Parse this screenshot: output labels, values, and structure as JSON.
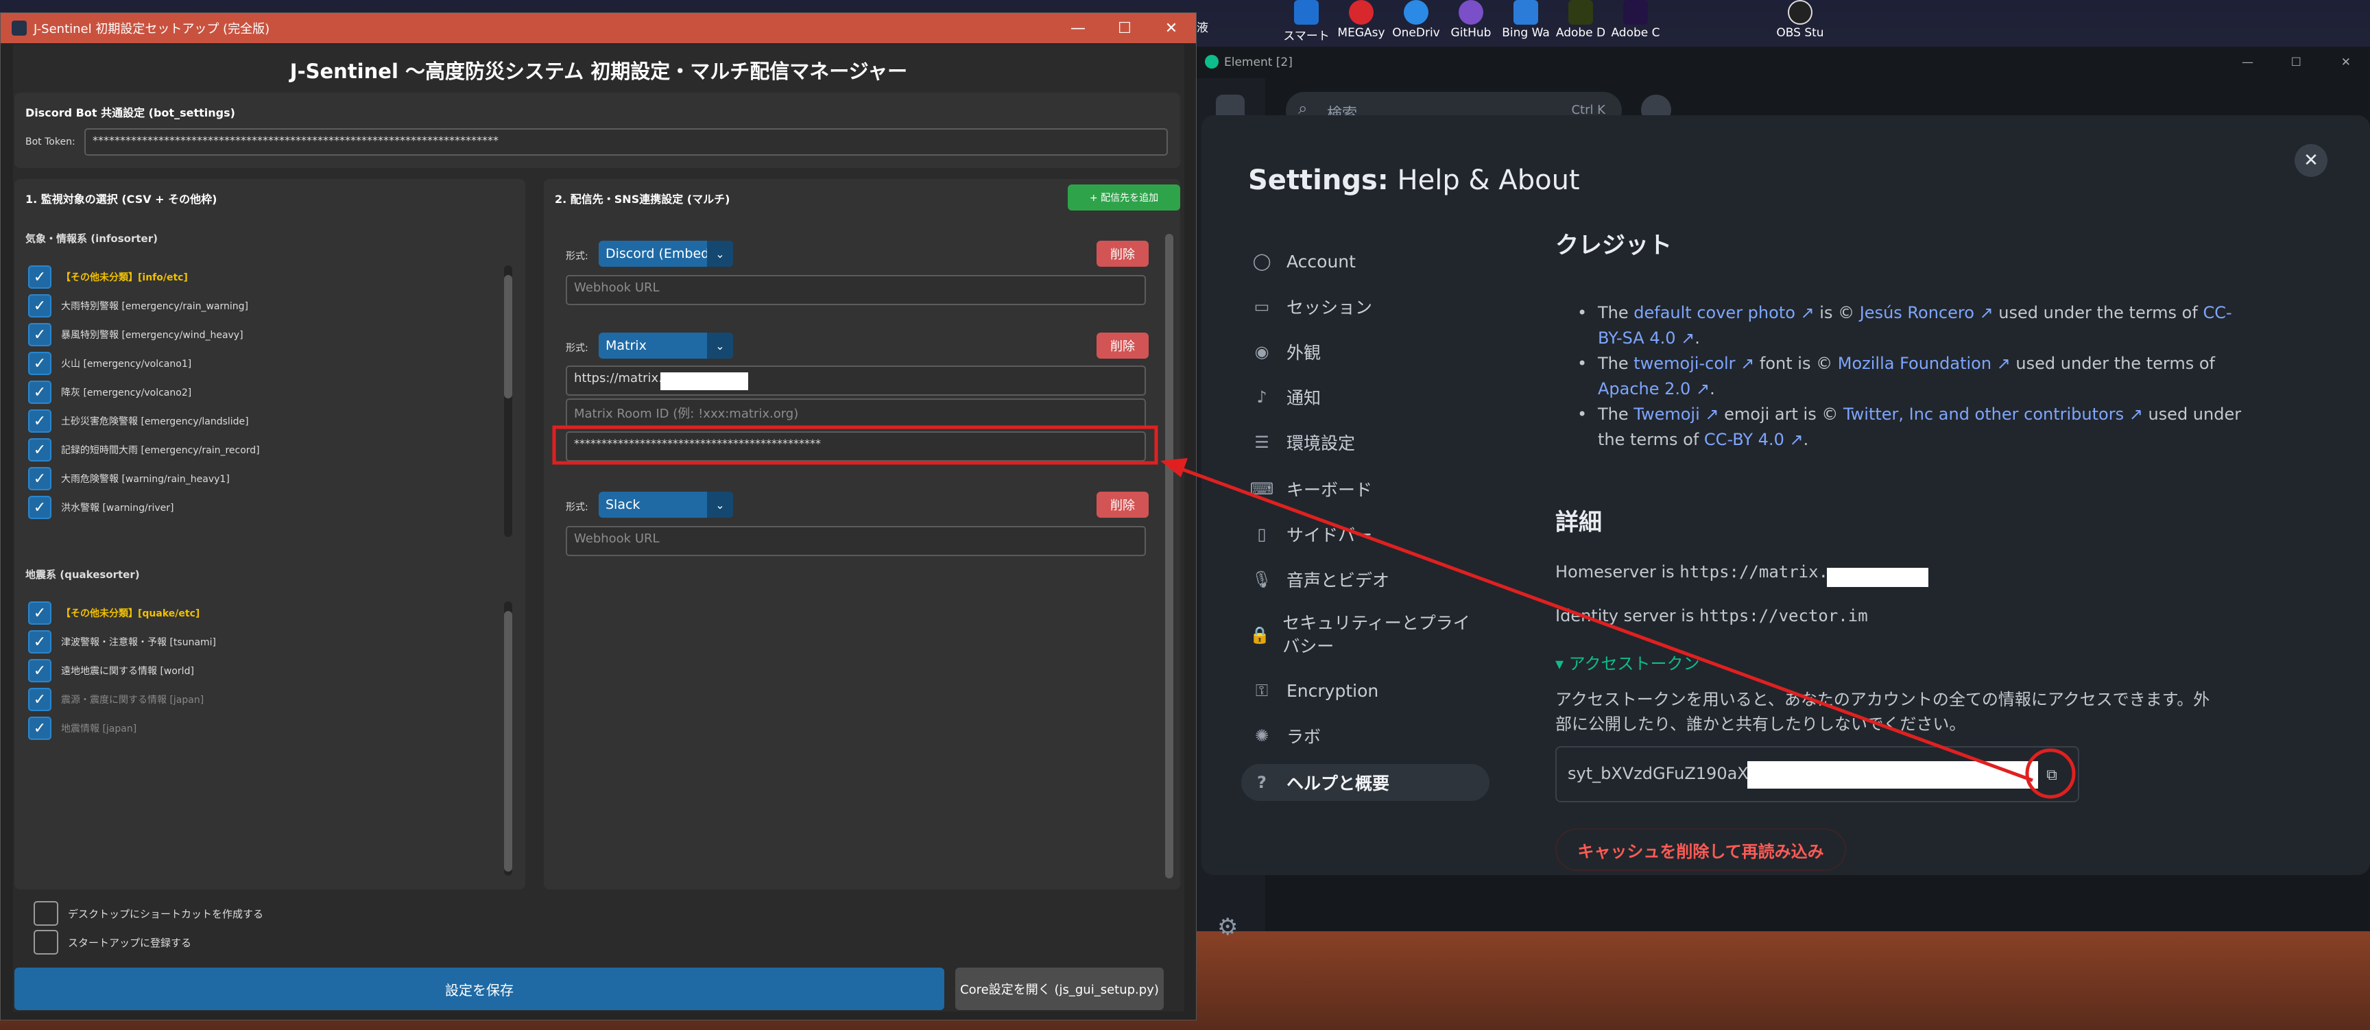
{
  "desktop": {
    "taskbar_items": [
      "スマートフ",
      "MEGAsy",
      "OneDriv",
      "GitHub",
      "Bing Wa",
      "Adobe D",
      "Adobe C",
      "OBS Stu"
    ],
    "partial_item": "液"
  },
  "jsentinel": {
    "window_title": "J-Sentinel 初期設定セットアップ (完全版)",
    "heading": "J-Sentinel ～高度防災システム 初期設定・マルチ配信マネージャー",
    "bot_section": {
      "title": "Discord Bot 共通設定 (bot_settings)",
      "token_label": "Bot Token:",
      "token_value": "**************************************************************************"
    },
    "targets": {
      "title": "1. 監視対象の選択 (CSV + その他枠)",
      "weather_group": "気象・情報系 (infosorter)",
      "weather_items": [
        {
          "text": "【その他未分類】[info/etc]",
          "checked": true
        },
        {
          "text": "大雨特別警報 [emergency/rain_warning]",
          "checked": true
        },
        {
          "text": "暴風特別警報 [emergency/wind_heavy]",
          "checked": true
        },
        {
          "text": "火山 [emergency/volcano1]",
          "checked": true
        },
        {
          "text": "降灰 [emergency/volcano2]",
          "checked": true
        },
        {
          "text": "土砂災害危険警報 [emergency/landslide]",
          "checked": true
        },
        {
          "text": "記録的短時間大雨 [emergency/rain_record]",
          "checked": true
        },
        {
          "text": "大雨危険警報 [warning/rain_heavy1]",
          "checked": true
        },
        {
          "text": "洪水警報 [warning/river]",
          "checked": true
        }
      ],
      "quake_group": "地震系 (quakesorter)",
      "quake_items": [
        {
          "text": "【その他未分類】[quake/etc]",
          "checked": true
        },
        {
          "text": "津波警報・注意報・予報 [tsunami]",
          "checked": true
        },
        {
          "text": "遠地地震に関する情報 [world]",
          "checked": true
        },
        {
          "text": "震源・震度に関する情報 [japan]",
          "checked": true
        },
        {
          "text": "地震情報 [japan]",
          "checked": true
        }
      ]
    },
    "destinations": {
      "title": "2. 配信先・SNS連携設定 (マルチ)",
      "add_button": "+ 配信先を追加",
      "format_label": "形式:",
      "delete_label": "削除",
      "entries": [
        {
          "type": "Discord (Embed)",
          "fields": [
            {
              "value": "",
              "placeholder": "Webhook URL"
            }
          ]
        },
        {
          "type": "Matrix",
          "fields": [
            {
              "value": "https://matrix.",
              "placeholder": ""
            },
            {
              "value": "",
              "placeholder": "Matrix Room ID (例: !xxx:matrix.org)"
            },
            {
              "value": "*********************************************",
              "placeholder": ""
            }
          ]
        },
        {
          "type": "Slack",
          "fields": [
            {
              "value": "",
              "placeholder": "Webhook URL"
            }
          ]
        }
      ]
    },
    "options": {
      "shortcut": "デスクトップにショートカットを作成する",
      "startup": "スタートアップに登録する"
    },
    "buttons": {
      "save": "設定を保存",
      "core": "Core設定を開く (js_gui_setup.py)"
    }
  },
  "element": {
    "window_title": "Element [2]",
    "search_placeholder": "検索",
    "search_shortcut": "Ctrl K",
    "settings_title_bold": "Settings:",
    "settings_title_rest": " Help & About",
    "nav": [
      {
        "label": "Account",
        "icon": "account-icon"
      },
      {
        "label": "セッション",
        "icon": "devices-icon"
      },
      {
        "label": "外観",
        "icon": "eye-icon"
      },
      {
        "label": "通知",
        "icon": "bell-icon"
      },
      {
        "label": "環境設定",
        "icon": "preferences-icon"
      },
      {
        "label": "キーボード",
        "icon": "keyboard-icon"
      },
      {
        "label": "サイドバー",
        "icon": "sidebar-icon"
      },
      {
        "label": "音声とビデオ",
        "icon": "microphone-icon"
      },
      {
        "label": "セキュリティーとプライバシー",
        "icon": "lock-icon"
      },
      {
        "label": "Encryption",
        "icon": "key-icon"
      },
      {
        "label": "ラボ",
        "icon": "bulb-icon"
      },
      {
        "label": "ヘルプと概要",
        "icon": "help-icon",
        "active": true
      }
    ],
    "credits_heading": "クレジット",
    "credits": [
      {
        "p1": "The ",
        "link1": "default cover photo",
        "p2": " is © ",
        "link2": "Jesús Roncero",
        "p3": " used under the terms of ",
        "link3": "CC-BY-SA 4.0",
        "p4": "."
      },
      {
        "p1": "The ",
        "link1": "twemoji-colr",
        "p2": " font is © ",
        "link2": "Mozilla Foundation",
        "p3": " used under the terms of ",
        "link3": "Apache 2.0",
        "p4": "."
      },
      {
        "p1": "The ",
        "link1": "Twemoji",
        "p2": " emoji art is © ",
        "link2": "Twitter, Inc and other contributors",
        "p3": " used under the terms of ",
        "link3": "CC-BY 4.0",
        "p4": "."
      }
    ],
    "details_heading": "詳細",
    "homeserver_label": "Homeserver is ",
    "homeserver_value": "https://matrix.",
    "identity_label": "Identity server is ",
    "identity_value": "https://vector.im",
    "access_token_toggle": "▾ アクセストークン",
    "access_token_desc_1": "アクセストークンを用いると、あなたのアカウントの全ての情報にアクセスできます。外",
    "access_token_desc_2": "部に公開したり、誰かと共有したりしないでください。",
    "access_token_value": "syt_bXVzdGFuZ190aXI",
    "clear_cache_button": "キャッシュを削除して再読み込み"
  },
  "colors": {
    "accent_blue": "#1f6aa5",
    "danger_red": "#d35454",
    "add_green": "#2fa34a",
    "annotation_red": "#e02020",
    "element_link": "#7ea6ff",
    "element_warning": "#ff5b55",
    "element_green": "#0dbd8b"
  }
}
